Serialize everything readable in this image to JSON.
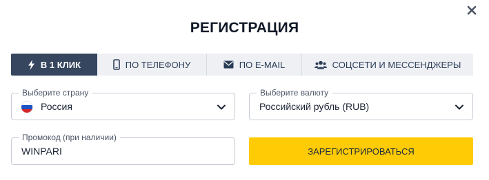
{
  "dialog": {
    "title": "РЕГИСТРАЦИЯ",
    "close_icon": "close-icon"
  },
  "tabs": [
    {
      "label": "В 1 КЛИК",
      "icon": "lightning-icon",
      "active": true
    },
    {
      "label": "ПО ТЕЛЕФОНУ",
      "icon": "phone-icon",
      "active": false
    },
    {
      "label": "ПО E-MAIL",
      "icon": "envelope-icon",
      "active": false
    },
    {
      "label": "СОЦСЕТИ И МЕССЕНДЖЕРЫ",
      "icon": "users-icon",
      "active": false
    }
  ],
  "country": {
    "label": "Выберите страну",
    "value": "Россия",
    "flag_icon": "russia-flag-icon"
  },
  "currency": {
    "label": "Выберите валюту",
    "value": "Российский рубль (RUB)"
  },
  "promo": {
    "label": "Промокод (при наличии)",
    "value": "WINPARI"
  },
  "submit": {
    "label": "ЗАРЕГИСТРИРОВАТЬСЯ"
  },
  "colors": {
    "active_tab": "#35465e",
    "tab_bg": "#eef0f4",
    "button": "#ffcb05",
    "border": "#c6ccd5"
  }
}
